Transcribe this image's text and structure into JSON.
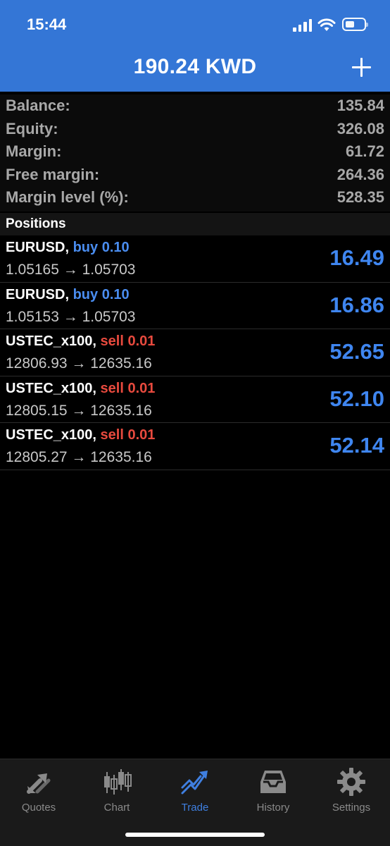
{
  "status_bar": {
    "time": "15:44"
  },
  "header": {
    "title": "190.24 KWD",
    "add_icon": "plus-icon"
  },
  "summary": [
    {
      "label": "Balance:",
      "value": "135.84"
    },
    {
      "label": "Equity:",
      "value": "326.08"
    },
    {
      "label": "Margin:",
      "value": "61.72"
    },
    {
      "label": "Free margin:",
      "value": "264.36"
    },
    {
      "label": "Margin level (%):",
      "value": "528.35"
    }
  ],
  "positions_header": "Positions",
  "positions": [
    {
      "symbol": "EURUSD,",
      "side": "buy 0.10",
      "type": "buy",
      "prices": "1.05165 → 1.05703",
      "profit": "16.49"
    },
    {
      "symbol": "EURUSD,",
      "side": "buy 0.10",
      "type": "buy",
      "prices": "1.05153 → 1.05703",
      "profit": "16.86"
    },
    {
      "symbol": "USTEC_x100,",
      "side": "sell 0.01",
      "type": "sell",
      "prices": "12806.93 → 12635.16",
      "profit": "52.65"
    },
    {
      "symbol": "USTEC_x100,",
      "side": "sell 0.01",
      "type": "sell",
      "prices": "12805.15 → 12635.16",
      "profit": "52.10"
    },
    {
      "symbol": "USTEC_x100,",
      "side": "sell 0.01",
      "type": "sell",
      "prices": "12805.27 → 12635.16",
      "profit": "52.14"
    }
  ],
  "tabs": [
    {
      "label": "Quotes",
      "icon": "quotes-arrows-icon",
      "active": false
    },
    {
      "label": "Chart",
      "icon": "candlestick-chart-icon",
      "active": false
    },
    {
      "label": "Trade",
      "icon": "trade-trend-icon",
      "active": true
    },
    {
      "label": "History",
      "icon": "inbox-history-icon",
      "active": false
    },
    {
      "label": "Settings",
      "icon": "gear-icon",
      "active": false
    }
  ],
  "colors": {
    "header_bg": "#3476d6",
    "buy": "#4a8df0",
    "sell": "#e84a3e",
    "profit": "#3f86f0",
    "active_tab": "#3f7fe0"
  }
}
